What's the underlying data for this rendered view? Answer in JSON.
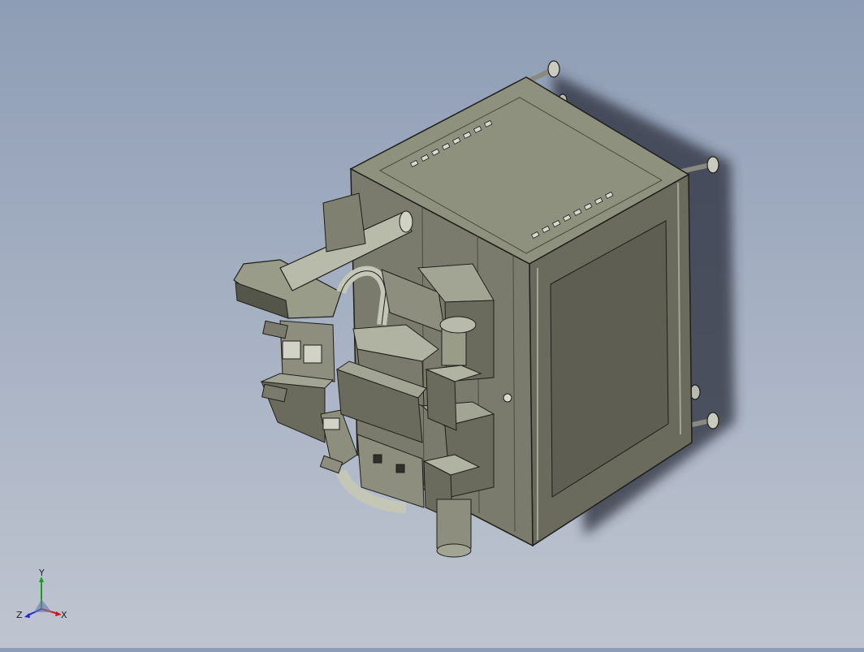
{
  "viewport": {
    "model": "cad-assembly-isometric",
    "colors": {
      "background_top": "#8e9db5",
      "background_bottom": "#bfc5d0",
      "body_front": "#6a6b5d",
      "body_top": "#8f917f",
      "body_side": "#7a7b6c",
      "edge": "#1f1f1a",
      "shadow": "#2a2f3a"
    }
  },
  "triad": {
    "x_label": "X",
    "y_label": "Y",
    "z_label": "Z",
    "x_color": "#d01818",
    "y_color": "#18a018",
    "z_color": "#1a2ad0"
  }
}
